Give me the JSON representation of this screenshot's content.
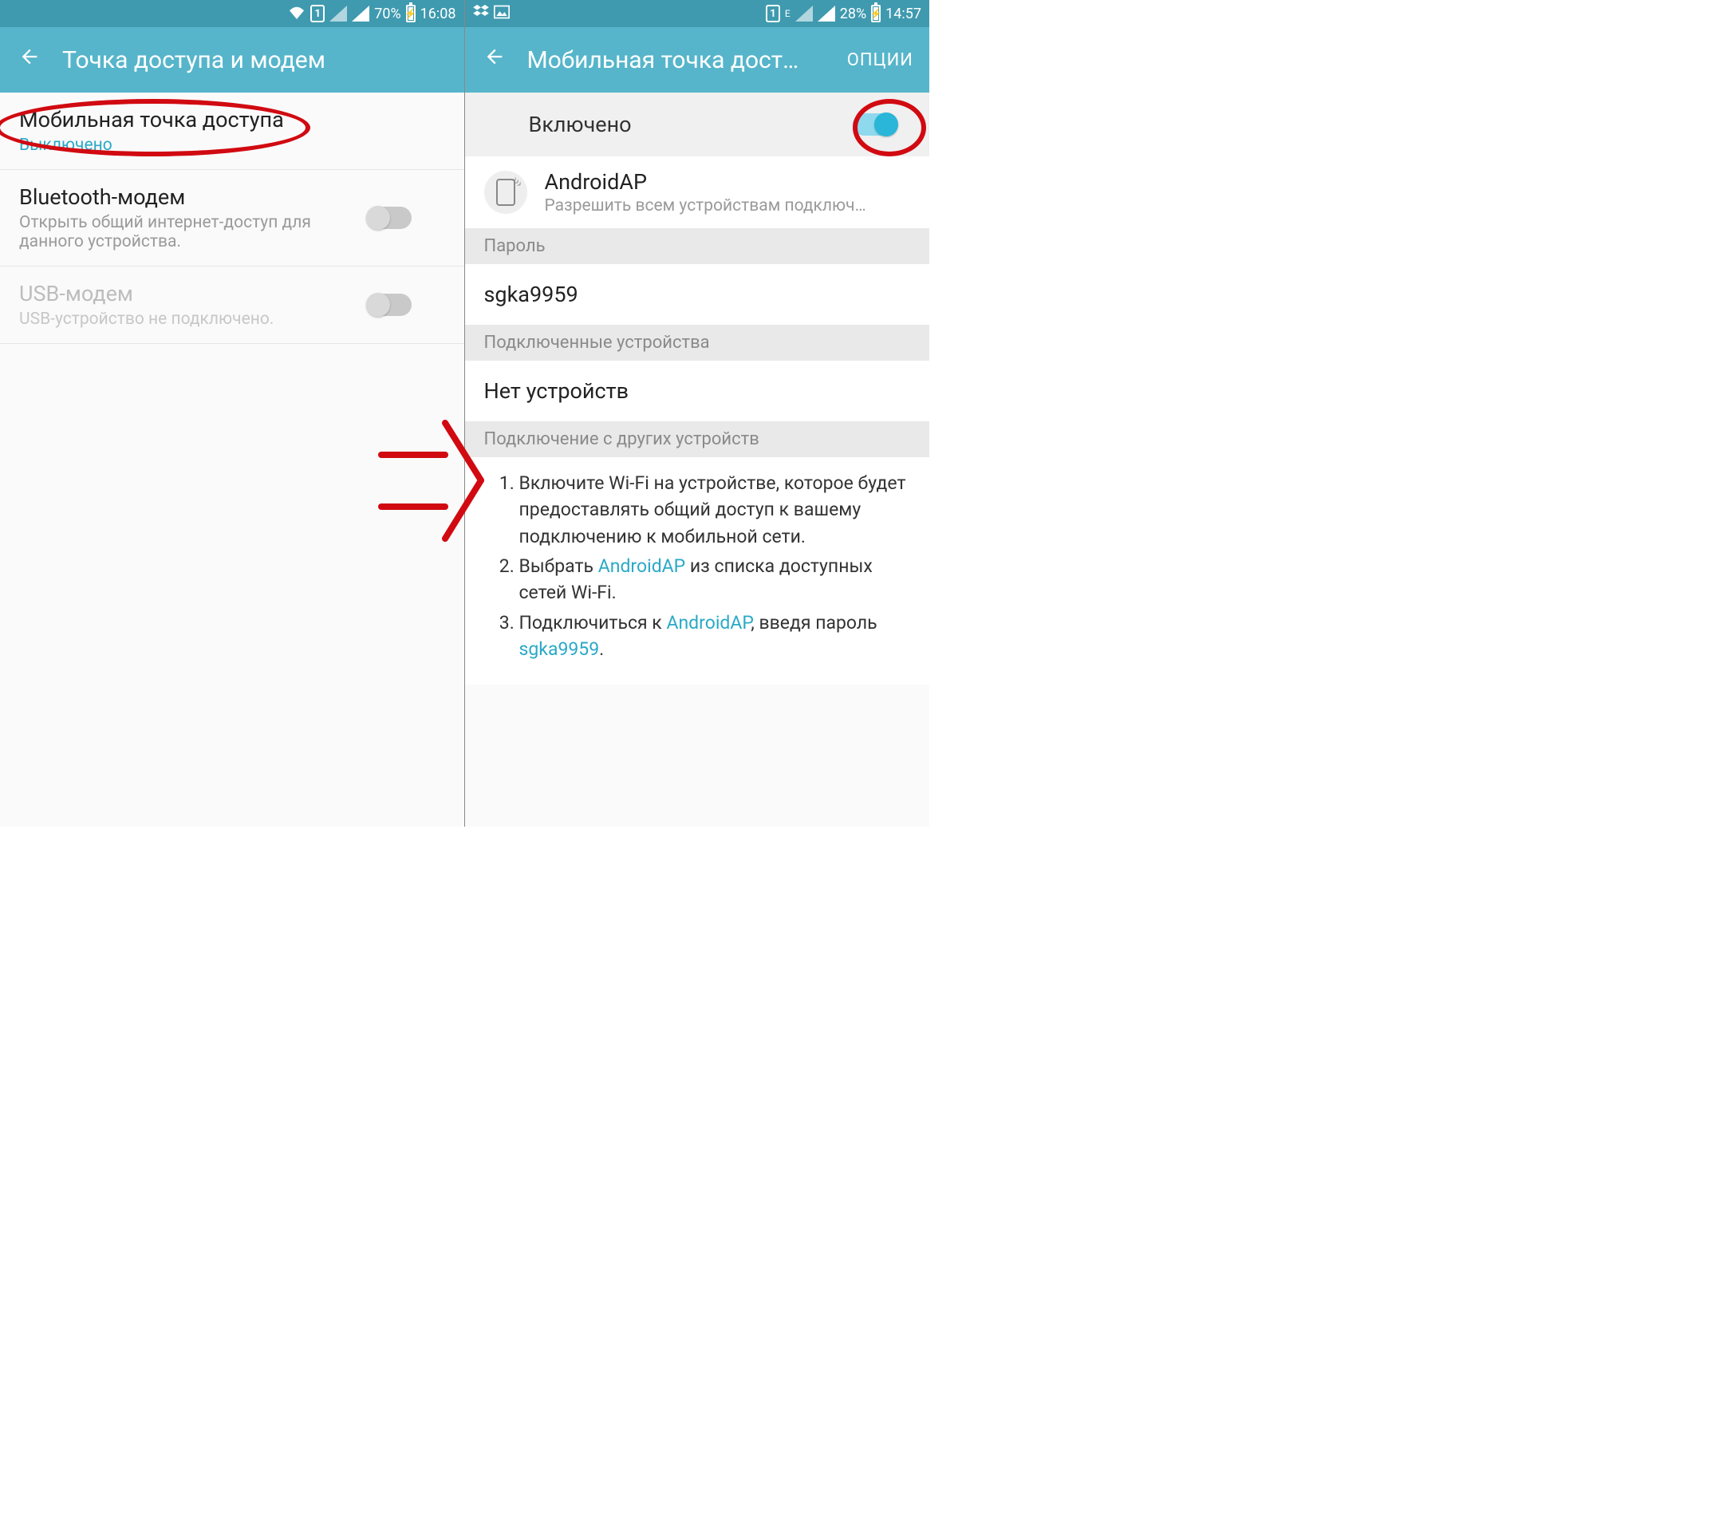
{
  "colors": {
    "accent": "#56b5ca",
    "accent_dark": "#3f9aaf",
    "link": "#2aa9c7",
    "annotation": "#d10a11"
  },
  "left": {
    "status": {
      "sim_label": "1",
      "battery_pct": "70%",
      "time": "16:08"
    },
    "appbar": {
      "title": "Точка доступа и модем"
    },
    "rows": {
      "hotspot": {
        "title": "Мобильная точка доступа",
        "subtitle": "Выключено"
      },
      "bt": {
        "title": "Bluetooth-модем",
        "subtitle": "Открыть общий интернет-доступ для данного устройства."
      },
      "usb": {
        "title": "USB-модем",
        "subtitle": "USB-устройство не подключено."
      }
    }
  },
  "right": {
    "status": {
      "sim_label": "1",
      "net_label": "E",
      "battery_pct": "28%",
      "time": "14:57"
    },
    "appbar": {
      "title": "Мобильная точка дост…",
      "action": "ОПЦИИ"
    },
    "enabled_label": "Включено",
    "ap": {
      "name": "AndroidAP",
      "desc": "Разрешить всем устройствам подключ…"
    },
    "password_header": "Пароль",
    "password_value": "sgka9959",
    "connected_header": "Подключенные устройства",
    "connected_value": "Нет устройств",
    "howto_header": "Подключение с других устройств",
    "instructions": {
      "step1": "Включите Wi-Fi на устройстве, которое будет предоставлять общий доступ к вашему подключению к мобильной сети.",
      "step2_a": "Выбрать ",
      "step2_link": "AndroidAP",
      "step2_b": " из списка доступных сетей Wi-Fi.",
      "step3_a": "Подключиться к ",
      "step3_link1": "AndroidAP",
      "step3_b": ", введя пароль ",
      "step3_link2": "sgka9959",
      "step3_c": "."
    }
  }
}
